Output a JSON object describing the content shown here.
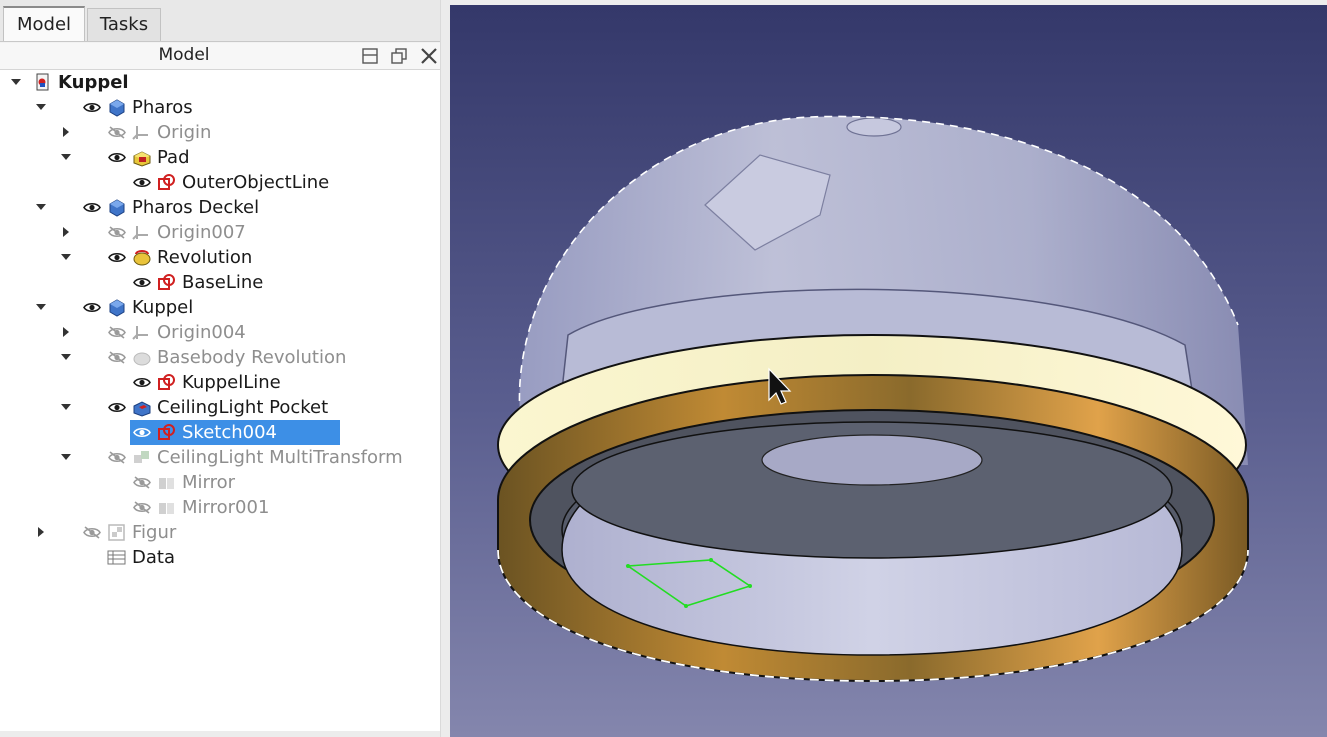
{
  "tabs": {
    "model": "Model",
    "tasks": "Tasks"
  },
  "panel": {
    "title": "Model"
  },
  "tree": [
    {
      "label": "Kuppel",
      "level": 0,
      "expanded": true,
      "bold": true,
      "gray": false,
      "icon": "document-icon",
      "eye": "none",
      "selected": false
    },
    {
      "label": "Pharos",
      "level": 1,
      "expanded": true,
      "bold": false,
      "gray": false,
      "icon": "body-icon",
      "eye": "visible",
      "selected": false
    },
    {
      "label": "Origin",
      "level": 2,
      "expanded": false,
      "bold": false,
      "gray": true,
      "icon": "origin-icon",
      "eye": "hidden",
      "selected": false
    },
    {
      "label": "Pad",
      "level": 2,
      "expanded": true,
      "bold": false,
      "gray": false,
      "icon": "pad-icon",
      "eye": "visible",
      "selected": false
    },
    {
      "label": "OuterObjectLine",
      "level": 3,
      "expanded": null,
      "bold": false,
      "gray": false,
      "icon": "sketch-icon",
      "eye": "visible",
      "selected": false
    },
    {
      "label": "Pharos Deckel",
      "level": 1,
      "expanded": true,
      "bold": false,
      "gray": false,
      "icon": "body-icon",
      "eye": "visible",
      "selected": false
    },
    {
      "label": "Origin007",
      "level": 2,
      "expanded": false,
      "bold": false,
      "gray": true,
      "icon": "origin-icon",
      "eye": "hidden",
      "selected": false
    },
    {
      "label": "Revolution",
      "level": 2,
      "expanded": true,
      "bold": false,
      "gray": false,
      "icon": "revolution-icon",
      "eye": "visible",
      "selected": false
    },
    {
      "label": "BaseLine",
      "level": 3,
      "expanded": null,
      "bold": false,
      "gray": false,
      "icon": "sketch-icon",
      "eye": "visible",
      "selected": false
    },
    {
      "label": "Kuppel",
      "level": 1,
      "expanded": true,
      "bold": false,
      "gray": false,
      "icon": "body-icon",
      "eye": "visible",
      "selected": false
    },
    {
      "label": "Origin004",
      "level": 2,
      "expanded": false,
      "bold": false,
      "gray": true,
      "icon": "origin-icon",
      "eye": "hidden",
      "selected": false
    },
    {
      "label": "Basebody Revolution",
      "level": 2,
      "expanded": true,
      "bold": false,
      "gray": true,
      "icon": "revolution-gray-icon",
      "eye": "hidden",
      "selected": false
    },
    {
      "label": "KuppelLine",
      "level": 3,
      "expanded": null,
      "bold": false,
      "gray": false,
      "icon": "sketch-icon",
      "eye": "visible",
      "selected": false
    },
    {
      "label": "CeilingLight Pocket",
      "level": 2,
      "expanded": true,
      "bold": false,
      "gray": false,
      "icon": "pocket-icon",
      "eye": "visible",
      "selected": false
    },
    {
      "label": "Sketch004",
      "level": 3,
      "expanded": null,
      "bold": false,
      "gray": false,
      "icon": "sketch-icon",
      "eye": "visible",
      "selected": true
    },
    {
      "label": "CeilingLight MultiTransform",
      "level": 2,
      "expanded": true,
      "bold": false,
      "gray": true,
      "icon": "multitransform-icon",
      "eye": "hidden",
      "selected": false
    },
    {
      "label": "Mirror",
      "level": 3,
      "expanded": null,
      "bold": false,
      "gray": true,
      "icon": "mirror-icon",
      "eye": "hidden",
      "selected": false
    },
    {
      "label": "Mirror001",
      "level": 3,
      "expanded": null,
      "bold": false,
      "gray": true,
      "icon": "mirror-icon",
      "eye": "hidden",
      "selected": false
    },
    {
      "label": "Figur",
      "level": 1,
      "expanded": false,
      "bold": false,
      "gray": true,
      "icon": "assembly-icon",
      "eye": "hidden",
      "selected": false
    },
    {
      "label": "Data",
      "level": 1,
      "expanded": null,
      "bold": false,
      "gray": false,
      "icon": "spreadsheet-icon",
      "eye": "none",
      "selected": false
    }
  ]
}
